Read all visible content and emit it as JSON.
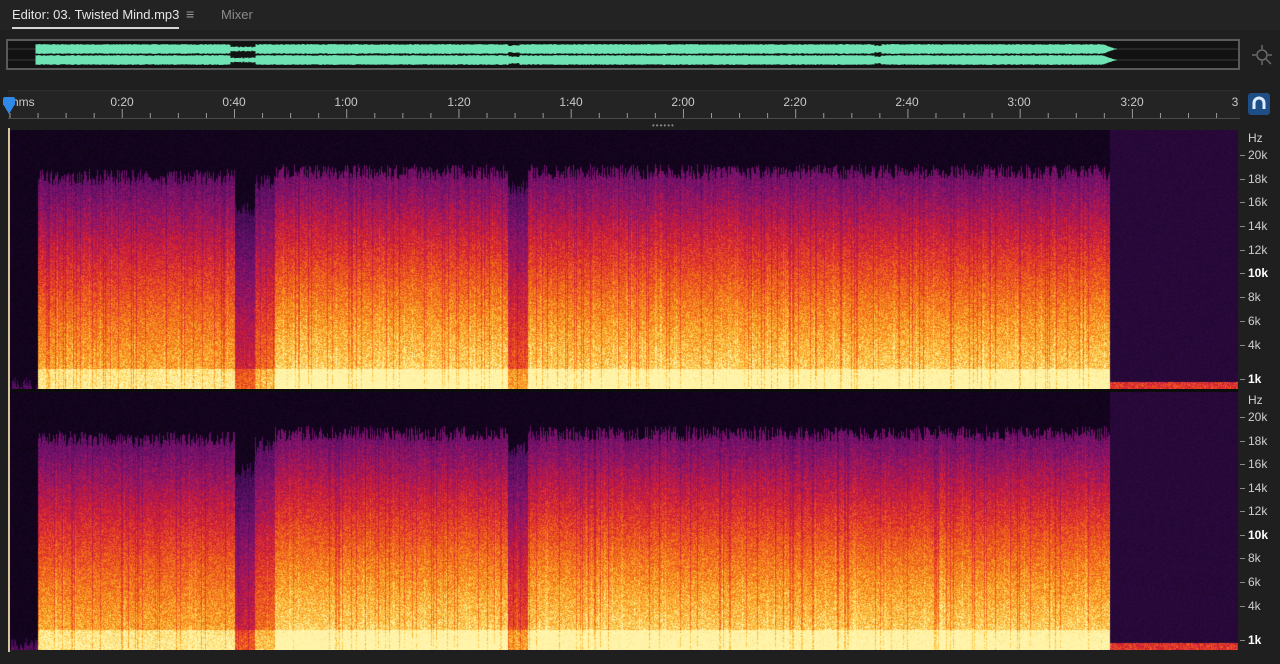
{
  "tabs": {
    "editor_label": "Editor: 03. Twisted Mind.mp3",
    "menu_icon": "hamburger-menu-icon",
    "mixer_label": "Mixer"
  },
  "ruler": {
    "unit_label": "hms",
    "labels": [
      "0:20",
      "0:40",
      "1:00",
      "1:20",
      "1:40",
      "2:00",
      "2:20",
      "2:40",
      "3:00",
      "3:20",
      "3"
    ]
  },
  "frequency_axis": {
    "unit_label": "Hz",
    "labels": [
      "20k",
      "18k",
      "16k",
      "14k",
      "12k",
      "10k",
      "8k",
      "6k",
      "4k",
      "1k"
    ],
    "bold_labels": [
      "10k",
      "1k"
    ]
  },
  "colors": {
    "waveform": "#6fe3b4",
    "playhead": "#2e8ae6",
    "snap_button": "#1d4f86",
    "spectrogram_low": "#1a0630",
    "spectrogram_high": "#fff1a0"
  },
  "icons": {
    "zoom": "zoom-navigator-icon",
    "snap": "snap-magnet-icon",
    "playhead": "playhead-marker-icon"
  }
}
